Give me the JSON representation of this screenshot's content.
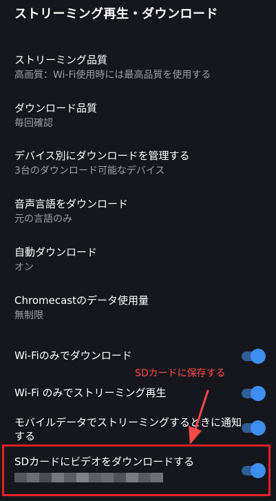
{
  "header": {
    "title": "ストリーミング再生・ダウンロード"
  },
  "settings": [
    {
      "title": "ストリーミング品質",
      "sub": "高画質：Wi-Fi使用時には最高品質を使用する"
    },
    {
      "title": "ダウンロード品質",
      "sub": "毎回確認"
    },
    {
      "title": "デバイス別にダウンロードを管理する",
      "sub": "3台のダウンロード可能なデバイス"
    },
    {
      "title": "音声言語をダウンロード",
      "sub": "元の言語のみ"
    },
    {
      "title": "自動ダウンロード",
      "sub": "オン"
    },
    {
      "title": "Chromecastのデータ使用量",
      "sub": "無制限"
    }
  ],
  "toggles": [
    {
      "label": "Wi-Fiのみでダウンロード",
      "state": "on"
    },
    {
      "label": "Wi-Fi のみでストリーミング再生",
      "state": "on"
    },
    {
      "label": "モバイルデータでストリーミングするときに通知する",
      "state": "on"
    },
    {
      "label": "SDカードにビデオをダウンロードする",
      "state": "on"
    }
  ],
  "annotation": {
    "text": "SDカードに保存する",
    "color": "#ff4a4a"
  },
  "colors": {
    "background": "#16171d",
    "toggle_track": "#2e5f96",
    "toggle_knob": "#3f8ef0",
    "highlight": "#e8202a"
  }
}
